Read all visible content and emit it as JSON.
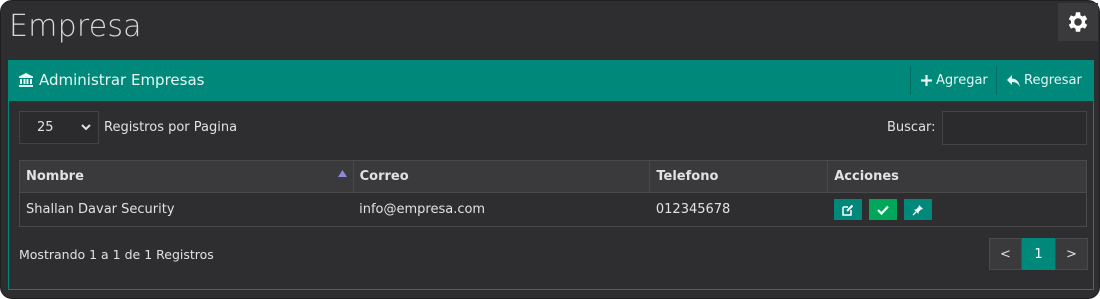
{
  "page": {
    "title": "Empresa"
  },
  "panel": {
    "title": "Administrar Empresas",
    "add_label": "Agregar",
    "back_label": "Regresar"
  },
  "controls": {
    "page_length": "25",
    "page_length_label": "Registros por Pagina",
    "search_label": "Buscar:",
    "search_value": ""
  },
  "table": {
    "headers": [
      "Nombre",
      "Correo",
      "Telefono",
      "Acciones"
    ],
    "rows": [
      {
        "nombre": "Shallan Davar Security",
        "correo": "info@empresa.com",
        "telefono": "012345678"
      }
    ]
  },
  "footer": {
    "info": "Mostrando 1 a 1 de 1 Registros",
    "prev": "<",
    "current_page": "1",
    "next": ">"
  },
  "colors": {
    "accent": "#00897b",
    "success": "#00a65a",
    "background": "#2e2d30"
  },
  "icons": [
    "gear-icon",
    "bank-icon",
    "plus-icon",
    "reply-icon",
    "chevron-down-icon",
    "sort-asc-icon",
    "edit-icon",
    "check-icon",
    "pin-icon"
  ]
}
